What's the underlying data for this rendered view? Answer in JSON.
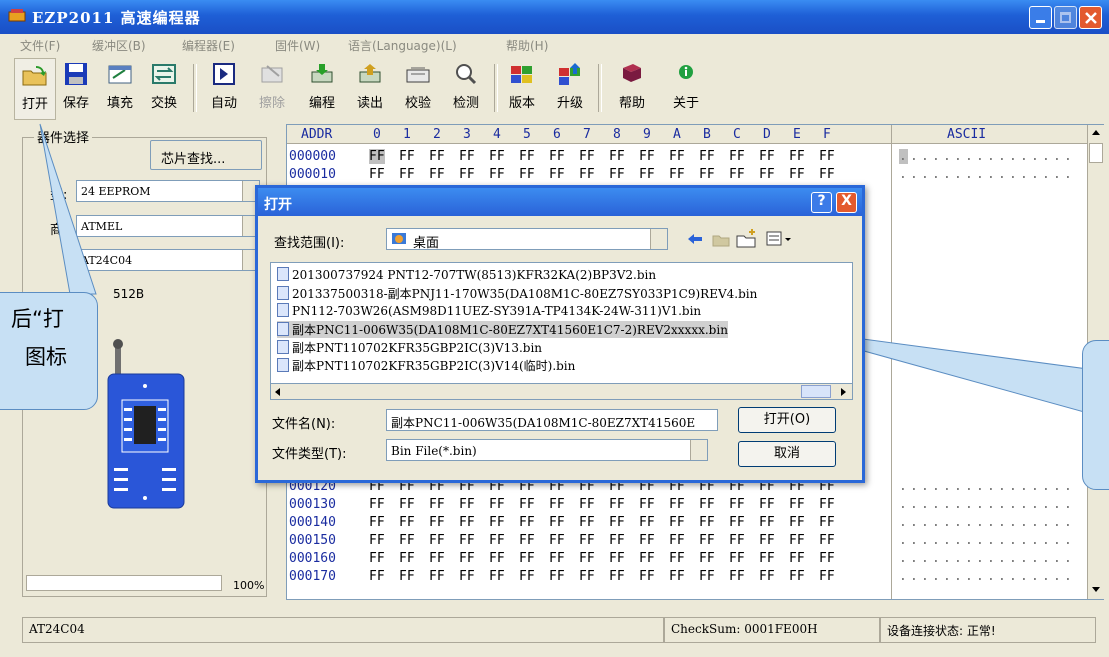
{
  "window": {
    "title": "EZP2011 高速编程器"
  },
  "menu": [
    "文件(F)",
    "缓冲区(B)",
    "编程器(E)",
    "固件(W)",
    "语言(Language)(L)",
    "帮助(H)"
  ],
  "toolbar": [
    {
      "label": "打开",
      "icon": "open-folder-icon",
      "enabled": true
    },
    {
      "label": "保存",
      "icon": "save-disk-icon",
      "enabled": true
    },
    {
      "label": "填充",
      "icon": "fill-icon",
      "enabled": true
    },
    {
      "label": "交换",
      "icon": "swap-icon",
      "enabled": true
    },
    {
      "label": "自动",
      "icon": "auto-icon",
      "enabled": true
    },
    {
      "label": "擦除",
      "icon": "erase-icon",
      "enabled": false
    },
    {
      "label": "编程",
      "icon": "program-icon",
      "enabled": true
    },
    {
      "label": "读出",
      "icon": "read-icon",
      "enabled": true
    },
    {
      "label": "校验",
      "icon": "verify-icon",
      "enabled": true
    },
    {
      "label": "检测",
      "icon": "detect-icon",
      "enabled": true
    },
    {
      "label": "版本",
      "icon": "version-icon",
      "enabled": true
    },
    {
      "label": "升级",
      "icon": "upgrade-icon",
      "enabled": true
    },
    {
      "label": "帮助",
      "icon": "help-book-icon",
      "enabled": true
    },
    {
      "label": "关于",
      "icon": "about-info-icon",
      "enabled": true
    }
  ],
  "device": {
    "group_label": "器件选择",
    "search_button": "芯片查找...",
    "type_label": "型:",
    "type_value": "24 EEPROM",
    "maker_label": "商:",
    "maker_value": "ATMEL",
    "chip_label": ":",
    "chip_value": "AT24C04",
    "size": "512B",
    "progress_text": "100%",
    "progress": 1.0
  },
  "hex": {
    "addr_header": "ADDR",
    "columns": [
      "0",
      "1",
      "2",
      "3",
      "4",
      "5",
      "6",
      "7",
      "8",
      "9",
      "A",
      "B",
      "C",
      "D",
      "E",
      "F"
    ],
    "ascii_header": "ASCII",
    "rows_top": [
      "000000",
      "000010"
    ],
    "rows_bottom": [
      "000120",
      "000130",
      "000140",
      "000150",
      "000160",
      "000170"
    ],
    "byte": "FF",
    "ascii_dot": "."
  },
  "status": {
    "chip": "AT24C04",
    "checksum": "CheckSum: 0001FE00H",
    "connection": "设备连接状态: 正常!"
  },
  "dialog": {
    "title": "打开",
    "look_in_label": "查找范围(I):",
    "look_in_value": "桌面",
    "files": [
      "201300737924  PNT12-707TW(8513)KFR32KA(2)BP3V2.bin",
      "201337500318-副本PNJ11-170W35(DA108M1C-80EZ7SY033P1C9)REV4.bin",
      "PN112-703W26(ASM98D11UEZ-SY391A-TP4134K-24W-311)V1.bin",
      "副本PNC11-006W35(DA108M1C-80EZ7XT41560E1C7-2)REV2xxxxx.bin",
      "副本PNT110702KFR35GBP2IC(3)V13.bin",
      "副本PNT110702KFR35GBP2IC(3)V14(临时).bin"
    ],
    "selected_index": 3,
    "filename_label": "文件名(N):",
    "filename_value": "副本PNC11-006W35(DA108M1C-80EZ7XT41560E",
    "filetype_label": "文件类型(T):",
    "filetype_value": "Bin File(*.bin)",
    "open_button": "打开(O)",
    "cancel_button": "取消",
    "help_button": "?",
    "close_button": "X"
  },
  "annotations": {
    "left_line1": "后“打",
    "left_line2": "图标"
  },
  "colors": {
    "titlebar": "#1E5FD6",
    "window_bg": "#ECE9D8",
    "hex_addr": "#1A2CA0"
  }
}
